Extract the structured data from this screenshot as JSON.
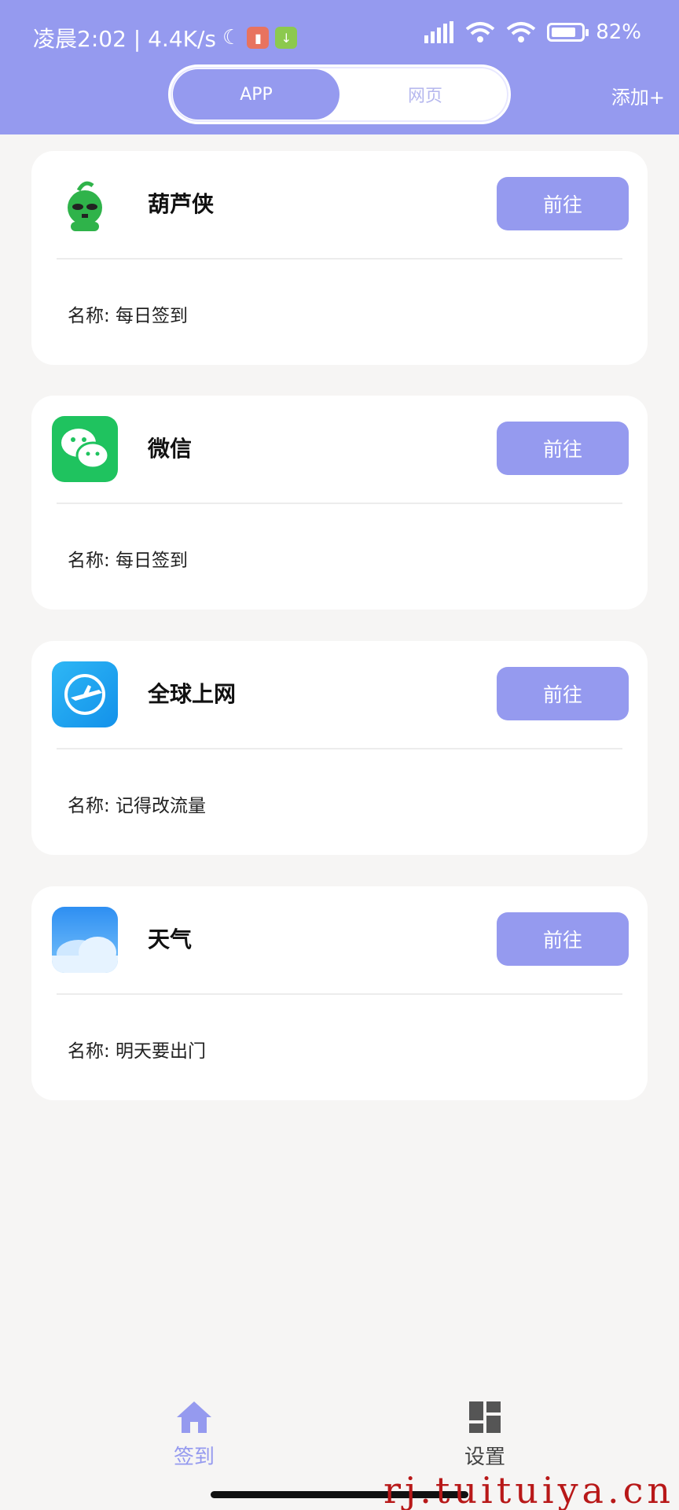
{
  "status_bar": {
    "time_speed": "凌晨2:02 | 4.4K/s",
    "battery": "82%",
    "battery_level": 0.82
  },
  "header": {
    "tabs": [
      {
        "label": "APP",
        "active": true
      },
      {
        "label": "网页",
        "active": false
      }
    ],
    "add_label": "添加+"
  },
  "accent_color": "#959aef",
  "cards": [
    {
      "name": "葫芦侠",
      "icon": "huluxia-app-icon",
      "button": "前往",
      "detail": "名称: 每日签到"
    },
    {
      "name": "微信",
      "icon": "wechat-app-icon",
      "button": "前往",
      "detail": "名称: 每日签到"
    },
    {
      "name": "全球上网",
      "icon": "global-internet-app-icon",
      "button": "前往",
      "detail": "名称: 记得改流量"
    },
    {
      "name": "天气",
      "icon": "weather-app-icon",
      "button": "前往",
      "detail": "名称: 明天要出门"
    }
  ],
  "bottom_nav": [
    {
      "label": "签到",
      "icon": "home-icon",
      "active": true
    },
    {
      "label": "设置",
      "icon": "grid-icon",
      "active": false
    }
  ],
  "watermark": "rj.tuituiya.cn"
}
